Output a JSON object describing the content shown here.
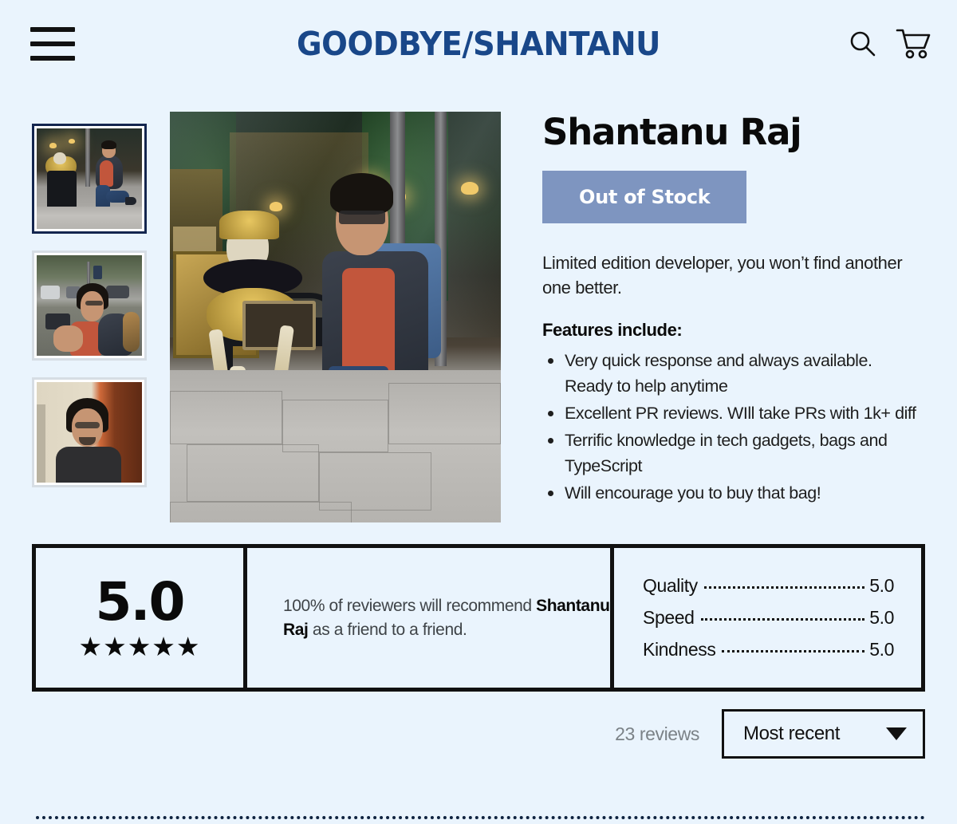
{
  "header": {
    "menu_icon": "hamburger-menu-icon",
    "brand": "GOODBYE/SHANTANU",
    "search_icon": "search-icon",
    "cart_icon": "shopping-cart-icon"
  },
  "gallery": {
    "thumbnails": [
      {
        "alt": "Shantanu kneeling beside skeleton statue outside cafe",
        "selected": true
      },
      {
        "alt": "Shantanu taking a photo with phone on a street",
        "selected": false
      },
      {
        "alt": "Shantanu portrait indoors",
        "selected": false
      }
    ],
    "hero_alt": "Shantanu kneeling beside a decorated skeleton on a chair outside a cafe window"
  },
  "product": {
    "title": "Shantanu Raj",
    "stock_label": "Out of Stock",
    "description": "Limited edition developer, you won’t find another one better.",
    "features_heading": "Features include:",
    "features": [
      "Very quick response and always available. Ready to help anytime",
      "Excellent PR reviews. WIll take PRs with 1k+ diff",
      "Terrific knowledge in tech gadgets, bags and TypeScript",
      "Will encourage you to buy that bag!"
    ]
  },
  "reviews_summary": {
    "score": "5.0",
    "stars": "★★★★★",
    "recommend_prefix": "100% of reviewers will recommend ",
    "recommend_name": "Shantanu Raj",
    "recommend_suffix": " as a friend to a friend.",
    "breakdown": [
      {
        "label": "Quality",
        "value": "5.0"
      },
      {
        "label": "Speed",
        "value": "5.0"
      },
      {
        "label": "Kindness",
        "value": "5.0"
      }
    ]
  },
  "reviews_bar": {
    "count_label": "23 reviews",
    "sort_value": "Most recent",
    "sort_options": [
      "Most recent"
    ],
    "caret_icon": "chevron-down-icon"
  },
  "colors": {
    "page_background": "#eaf4fd",
    "brand": "#194789",
    "stock_button": "#7e95c0",
    "selected_thumb_border": "#14264f",
    "muted_text": "#7b8287"
  }
}
